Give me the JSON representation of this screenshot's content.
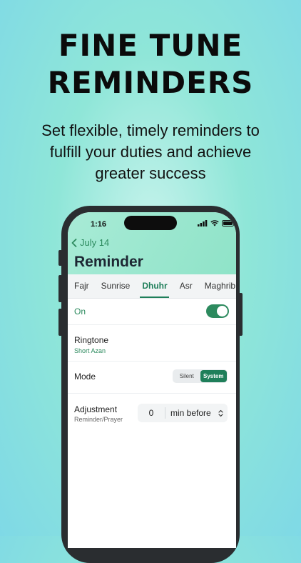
{
  "promo": {
    "headline_line1": "FINE TUNE",
    "headline_line2": "REMINDERS",
    "subtitle_line1": "Set flexible, timely reminders to",
    "subtitle_line2": "fulfill your duties and achieve",
    "subtitle_line3": "greater success"
  },
  "status_bar": {
    "time": "1:16",
    "icons": [
      "signal-icon",
      "wifi-icon",
      "battery-icon"
    ]
  },
  "nav": {
    "back_label": "July 14",
    "title": "Reminder"
  },
  "tabs": [
    {
      "label": "Fajr",
      "active": false
    },
    {
      "label": "Sunrise",
      "active": false
    },
    {
      "label": "Dhuhr",
      "active": true
    },
    {
      "label": "Asr",
      "active": false
    },
    {
      "label": "Maghrib",
      "active": false
    }
  ],
  "settings": {
    "on_label": "On",
    "on_enabled": true,
    "ringtone_label": "Ringtone",
    "ringtone_value": "Short Azan",
    "mode_label": "Mode",
    "mode_options": [
      "Silent",
      "System"
    ],
    "mode_selected": "System",
    "adjustment_label": "Adjustment",
    "adjustment_sub": "Reminder/Prayer",
    "adjustment_value": "0",
    "adjustment_unit": "min before"
  },
  "colors": {
    "accent": "#2c8a5e",
    "accent_dark": "#1f7f5a",
    "header_bg": "#a8ebd6",
    "page_bg": "#8fe6d8"
  }
}
